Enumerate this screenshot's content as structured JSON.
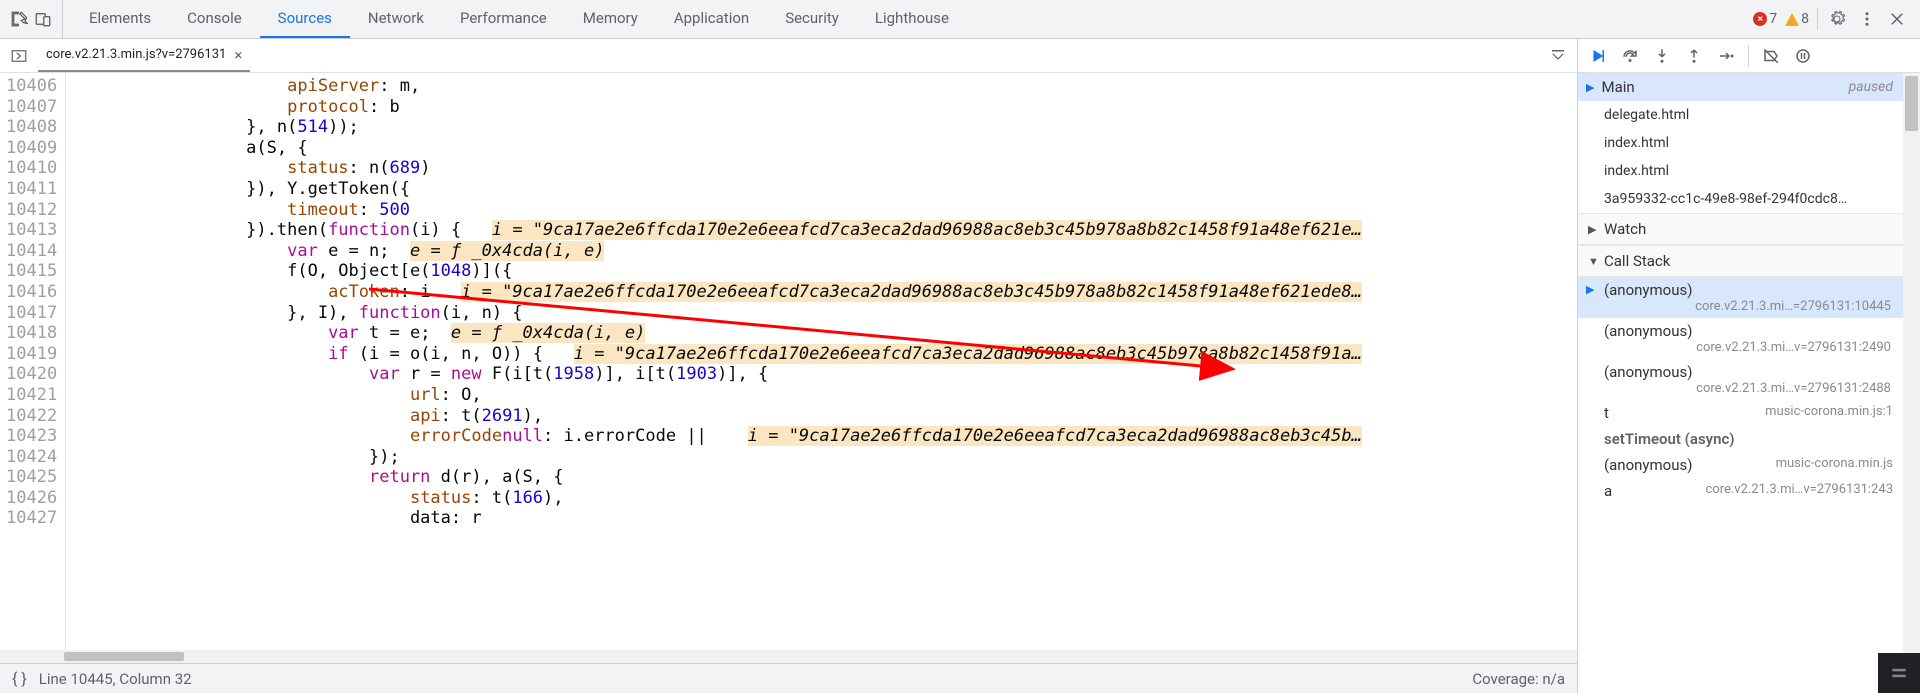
{
  "topTabs": {
    "elements": "Elements",
    "console": "Console",
    "sources": "Sources",
    "network": "Network",
    "performance": "Performance",
    "memory": "Memory",
    "application": "Application",
    "security": "Security",
    "lighthouse": "Lighthouse"
  },
  "counts": {
    "errors": "7",
    "warnings": "8"
  },
  "fileTab": {
    "name": "core.v2.21.3.min.js?v=2796131"
  },
  "gutter": {
    "start": 10406,
    "end": 10427
  },
  "code": {
    "l10406": {
      "ind": "                     ",
      "prop": "apiServer",
      "rest": ": m,"
    },
    "l10407": {
      "ind": "                     ",
      "prop": "protocol",
      "rest": ": b"
    },
    "l10408": {
      "text": "                 }, n(514));"
    },
    "l10409": {
      "text": "                 a(S, {"
    },
    "l10410": {
      "ind": "                     ",
      "prop": "status",
      "rest": ": n(689)"
    },
    "l10411": {
      "text": "                 }), Y.getToken({"
    },
    "l10412": {
      "ind": "                     ",
      "prop": "timeout",
      "rest": ": ",
      "num": "500"
    },
    "l10413": {
      "pre": "                 }).then(",
      "kw": "function",
      "mid": "(i) {   ",
      "hl": "i = \"9ca17ae2e6ffcda170e2e6eeafcd7ca3eca2dad96988ac8eb3c45b978a8b82c1458f91a48ef621e…"
    },
    "l10414": {
      "ind": "                     ",
      "kw": "var",
      "rest": " e = n;  ",
      "hl": "e = ƒ _0x4cda(i, e)"
    },
    "l10415": {
      "text": "                     f(O, Object[e(1048)]({"
    },
    "l10416": {
      "ind": "                         ",
      "prop": "acToken",
      "rest": ": i   ",
      "hl": "i = \"9ca17ae2e6ffcda170e2e6eeafcd7ca3eca2dad96988ac8eb3c45b978a8b82c1458f91a48ef621ede8…"
    },
    "l10417": {
      "pre": "                     }, I), ",
      "kw": "function",
      "rest": "(i, n) {"
    },
    "l10418": {
      "ind": "                         ",
      "kw": "var",
      "rest": " t = e;  ",
      "hl": "e = ƒ _0x4cda(i, e)"
    },
    "l10419": {
      "ind": "                         ",
      "kw": "if",
      "rest": " (i = o(i, n, O)) {   ",
      "hl": "i = \"9ca17ae2e6ffcda170e2e6eeafcd7ca3eca2dad96988ac8eb3c45b978a8b82c1458f91a…"
    },
    "l10420": {
      "ind": "                             ",
      "kw": "var",
      "rest": " r = ",
      "kw2": "new",
      "rest2": " F(i[t(1958)], i[t(1903)], {"
    },
    "l10421": {
      "ind": "                                 ",
      "prop": "url",
      "rest": ": O,"
    },
    "l10422": {
      "ind": "                                 ",
      "prop": "api",
      "rest": ": t(2691),"
    },
    "l10423": {
      "ind": "                                 ",
      "prop": "errorCode",
      "rest": ": i.errorCode || ",
      "kw": "null",
      "post": "   ",
      "hl": "i = \"9ca17ae2e6ffcda170e2e6eeafcd7ca3eca2dad96988ac8eb3c45b…"
    },
    "l10424": {
      "text": "                             });"
    },
    "l10425": {
      "ind": "                             ",
      "kw": "return",
      "rest": " d(r), a(S, {"
    },
    "l10426": {
      "ind": "                                 ",
      "prop": "status",
      "rest": ": t(166),"
    },
    "l10427": {
      "text": "                                 data: r"
    }
  },
  "threads": {
    "main": "Main",
    "paused": "paused",
    "items": [
      "delegate.html",
      "index.html",
      "index.html",
      "3a959332-cc1c-49e8-98ef-294f0cdc8…"
    ]
  },
  "sections": {
    "watch": "Watch",
    "callstack": "Call Stack"
  },
  "callstack": {
    "f0": {
      "fn": "(anonymous)",
      "loc": "core.v2.21.3.mi…=2796131:10445"
    },
    "f1": {
      "fn": "(anonymous)",
      "loc": "core.v2.21.3.mi…v=2796131:2490"
    },
    "f2": {
      "fn": "(anonymous)",
      "loc": "core.v2.21.3.mi…v=2796131:2488"
    },
    "f3": {
      "fn": "t",
      "loc": "music-corona.min.js:1"
    },
    "async": "setTimeout (async)",
    "f4": {
      "fn": "(anonymous)",
      "loc": "music-corona.min.js"
    },
    "f5": {
      "fn": "a",
      "loc": "core.v2.21.3.mi…v=2796131:243"
    }
  },
  "statusbar": {
    "pos": "Line 10445, Column 32",
    "coverage": "Coverage: n/a"
  }
}
